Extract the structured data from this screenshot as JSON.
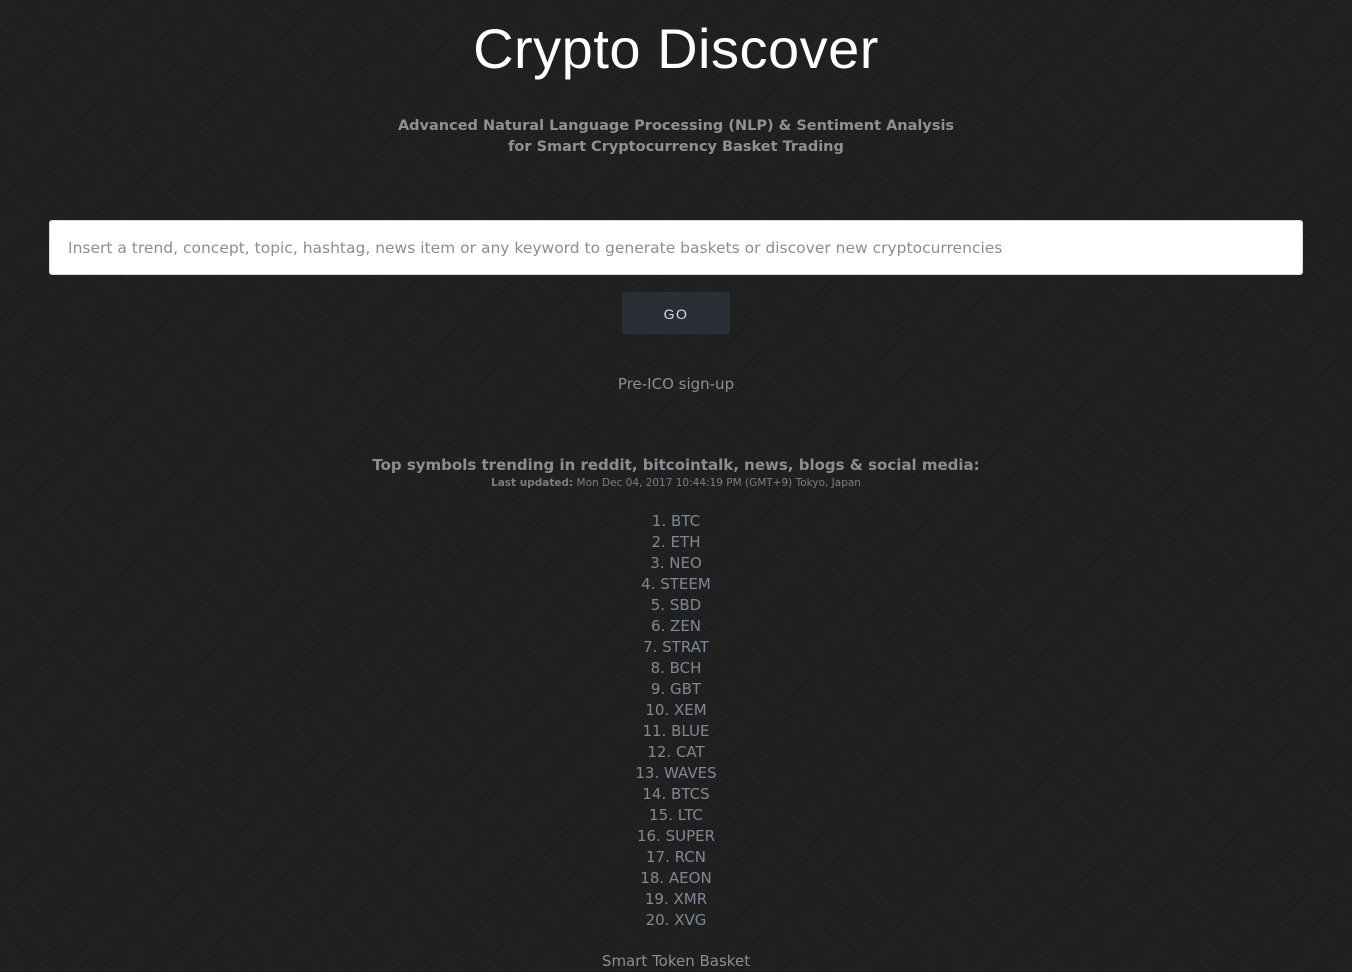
{
  "header": {
    "title": "Crypto Discover",
    "subtitle_line1": "Advanced Natural Language Processing (NLP) & Sentiment Analysis",
    "subtitle_line2": "for Smart Cryptocurrency Basket Trading"
  },
  "search": {
    "placeholder": "Insert a trend, concept, topic, hashtag, news item or any keyword to generate baskets or discover new cryptocurrencies",
    "value": ""
  },
  "actions": {
    "go_label": "GO",
    "preico_label": "Pre-ICO sign-up"
  },
  "trending": {
    "heading": "Top symbols trending in reddit, bitcointalk, news, blogs & social media:",
    "last_updated_label": "Last updated:",
    "last_updated_value": " Mon Dec 04, 2017 10:44:19 PM (GMT+9) Tokyo, Japan",
    "symbols": [
      {
        "rank": "1.",
        "symbol": "BTC"
      },
      {
        "rank": "2.",
        "symbol": "ETH"
      },
      {
        "rank": "3.",
        "symbol": "NEO"
      },
      {
        "rank": "4.",
        "symbol": "STEEM"
      },
      {
        "rank": "5.",
        "symbol": "SBD"
      },
      {
        "rank": "6.",
        "symbol": "ZEN"
      },
      {
        "rank": "7.",
        "symbol": "STRAT"
      },
      {
        "rank": "8.",
        "symbol": "BCH"
      },
      {
        "rank": "9.",
        "symbol": "GBT"
      },
      {
        "rank": "10.",
        "symbol": "XEM"
      },
      {
        "rank": "11.",
        "symbol": "BLUE"
      },
      {
        "rank": "12.",
        "symbol": "CAT"
      },
      {
        "rank": "13.",
        "symbol": "WAVES"
      },
      {
        "rank": "14.",
        "symbol": "BTCS"
      },
      {
        "rank": "15.",
        "symbol": "LTC"
      },
      {
        "rank": "16.",
        "symbol": "SUPER"
      },
      {
        "rank": "17.",
        "symbol": "RCN"
      },
      {
        "rank": "18.",
        "symbol": "AEON"
      },
      {
        "rank": "19.",
        "symbol": "XMR"
      },
      {
        "rank": "20.",
        "symbol": "XVG"
      }
    ]
  },
  "footer": {
    "cut_text": "Smart Token Basket"
  },
  "colors": {
    "background": "#202021",
    "title": "#ffffff",
    "muted_text": "#8a8e93",
    "button_bg": "#2a2f36",
    "input_bg": "#ffffff"
  }
}
